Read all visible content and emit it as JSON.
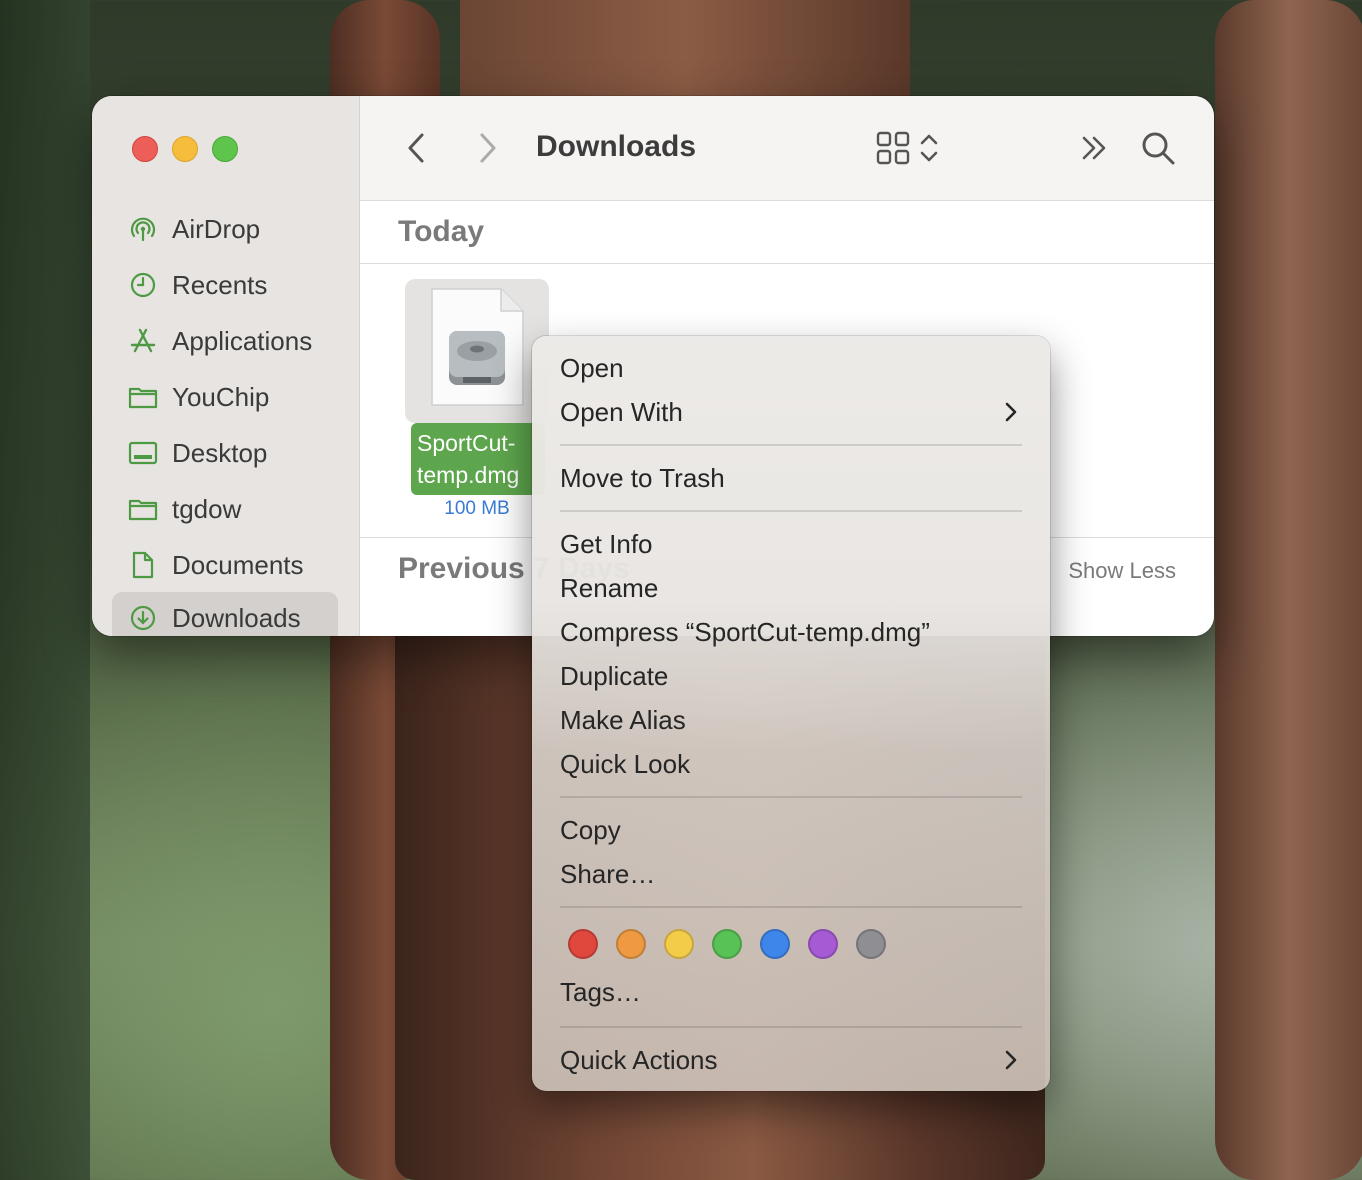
{
  "finder": {
    "title": "Downloads",
    "sidebar": {
      "items": [
        {
          "label": "AirDrop",
          "icon": "airdrop-icon"
        },
        {
          "label": "Recents",
          "icon": "clock-icon"
        },
        {
          "label": "Applications",
          "icon": "applications-icon"
        },
        {
          "label": "YouChip",
          "icon": "folder-icon"
        },
        {
          "label": "Desktop",
          "icon": "desktop-icon"
        },
        {
          "label": "tgdow",
          "icon": "folder-icon"
        },
        {
          "label": "Documents",
          "icon": "document-icon"
        },
        {
          "label": "Downloads",
          "icon": "download-icon"
        }
      ],
      "selected": "Downloads"
    },
    "sections": {
      "today": "Today",
      "previous": "Previous 7 Days",
      "show_less": "Show Less"
    },
    "file": {
      "name_line1": "SportCut-",
      "name_line2": "temp.dmg",
      "size": "100 MB"
    }
  },
  "context_menu": {
    "open": "Open",
    "open_with": "Open With",
    "move_to_trash": "Move to Trash",
    "get_info": "Get Info",
    "rename": "Rename",
    "compress": "Compress “SportCut-temp.dmg”",
    "duplicate": "Duplicate",
    "make_alias": "Make Alias",
    "quick_look": "Quick Look",
    "copy": "Copy",
    "share": "Share…",
    "tags": "Tags…",
    "quick_actions": "Quick Actions",
    "tag_colors": [
      "#e0473d",
      "#ed9a42",
      "#f3cc4a",
      "#58c257",
      "#3e86ea",
      "#a65bd5",
      "#8e8e93"
    ]
  },
  "colors": {
    "accent_green": "#5ea64d",
    "sidebar_icon": "#4e9a44",
    "size_blue": "#3a7bd5"
  }
}
